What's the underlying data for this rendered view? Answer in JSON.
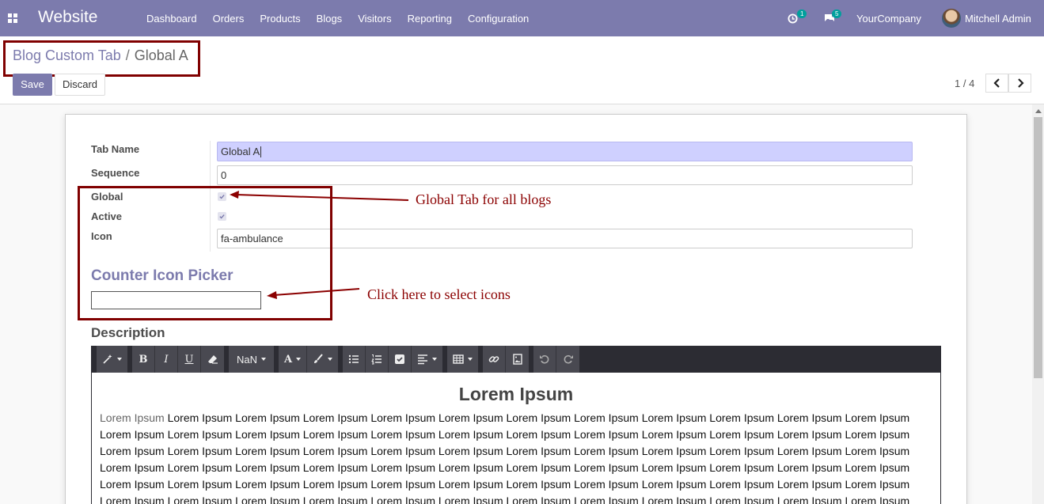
{
  "navbar": {
    "brand": "Website",
    "menu": [
      "Dashboard",
      "Orders",
      "Products",
      "Blogs",
      "Visitors",
      "Reporting",
      "Configuration"
    ],
    "activity_count": "1",
    "message_count": "5",
    "company": "YourCompany",
    "user": "Mitchell Admin"
  },
  "breadcrumb": {
    "parent": "Blog Custom Tab",
    "separator": "/",
    "current": "Global A"
  },
  "actions": {
    "save_label": "Save",
    "discard_label": "Discard"
  },
  "pager": {
    "value": "1 / 4"
  },
  "form": {
    "tab_name_label": "Tab Name",
    "tab_name_value": "Global A",
    "sequence_label": "Sequence",
    "sequence_value": "0",
    "global_label": "Global",
    "global_checked": true,
    "active_label": "Active",
    "active_checked": true,
    "icon_label": "Icon",
    "icon_value": "fa-ambulance",
    "counter_title": "Counter Icon Picker",
    "description_label": "Description"
  },
  "annotations": {
    "global_note": "Global Tab for all blogs",
    "picker_note": "Click here to select icons"
  },
  "editor": {
    "font_size_label": "NaN",
    "heading": "Lorem Ipsum",
    "first_words": "Lorem Ipsum",
    "body": "Lorem Ipsum Lorem Ipsum Lorem Ipsum Lorem Ipsum Lorem Ipsum Lorem Ipsum Lorem Ipsum Lorem Ipsum Lorem Ipsum Lorem Ipsum Lorem Ipsum Lorem Ipsum Lorem Ipsum Lorem Ipsum Lorem Ipsum Lorem Ipsum Lorem Ipsum Lorem Ipsum Lorem Ipsum Lorem Ipsum Lorem Ipsum Lorem Ipsum Lorem Ipsum Lorem Ipsum Lorem Ipsum Lorem Ipsum Lorem Ipsum Lorem Ipsum Lorem Ipsum Lorem Ipsum Lorem Ipsum Lorem Ipsum Lorem Ipsum Lorem Ipsum Lorem Ipsum Lorem Ipsum Lorem Ipsum Lorem Ipsum Lorem Ipsum Lorem Ipsum Lorem Ipsum Lorem Ipsum Lorem Ipsum Lorem Ipsum Lorem Ipsum Lorem Ipsum Lorem Ipsum Lorem Ipsum Lorem Ipsum Lorem Ipsum Lorem Ipsum Lorem Ipsum Lorem Ipsum Lorem Ipsum Lorem Ipsum Lorem Ipsum Lorem Ipsum Lorem Ipsum Lorem Ipsum Lorem Ipsum Lorem Ipsum Lorem Ipsum Lorem Ipsum Lorem Ipsum Lorem Ipsum Lorem Ipsum Lorem Ipsum Lorem Ipsum Lorem Ipsum Lorem Ipsum Lorem Ipsum Lorem Ipsum Lorem Ipsum Lorem Ipsum Lorem Ipsum Lorem Ipsum y"
  },
  "colors": {
    "brand": "#7c7bad",
    "annotation": "#8b0000",
    "focused_input": "#cfd0ff",
    "toolbar": "#2c2c33"
  }
}
